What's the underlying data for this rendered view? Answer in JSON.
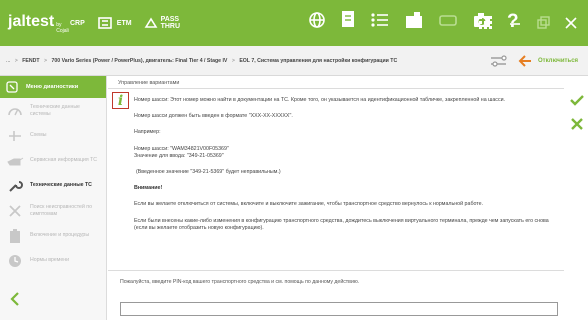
{
  "header": {
    "logo": "jaltest",
    "logo_sub": "by Cojali",
    "crp_label": "CRP",
    "etm_label": "ETM",
    "pass_thru_label_1": "PASS",
    "pass_thru_label_2": "THRU",
    "colors": {
      "brand_green": "#7db83a",
      "alert_red": "#c0392b"
    }
  },
  "breadcrumb": {
    "home": "...",
    "items": [
      "FENDT",
      "700 Vario Series (Power / PowerPlus), двигатель: Final Tier 4 / Stage IV",
      "EOL 7, Система управления для настройки конфигурации ТС"
    ],
    "back_label": "Отключиться"
  },
  "sidebar": {
    "header": "Меню диагностики",
    "items": [
      {
        "label": "Техническиe данные системы",
        "icon": "gauge-icon",
        "active": false
      },
      {
        "label": "Схемы",
        "icon": "schematic-icon",
        "active": false
      },
      {
        "label": "Сервисная информация ТС",
        "icon": "oil-can-icon",
        "active": false
      },
      {
        "label": "Технические данные ТС",
        "icon": "wrench-icon",
        "active": true
      },
      {
        "label": "Поиск неисправностей по симптомам",
        "icon": "tools-icon",
        "active": false
      },
      {
        "label": "Включение и процедуры",
        "icon": "battery-icon",
        "active": false
      },
      {
        "label": "Нормы времени",
        "icon": "clock-icon",
        "active": false
      }
    ]
  },
  "main": {
    "title": "Управление вариантами",
    "paragraphs": [
      "Номер шасси: Этот номер можно найти в документации на ТС. Кроме того, он указывается на идентификационной табличке, закрепленной на шасси.",
      "Номер шасси должен быть введен в формате \"XXX-XX-XXXXX\".",
      "Например:",
      "Номер шасси: \"WAM34821V00F05369\"",
      "Значение для ввода: \"349-21-05369\"",
      "(Введенное значение \"349-21-5369\" будет неправильным.)",
      "Внимание!",
      "Если вы желаете отключиться от системы, включите и выключите зажигание, чтобы транспортное средство вернулось к нормальной работе.",
      "Если были внесены какие-либо изменения в конфигурацию транспортного средства, дождитесь выключения виртуального терминала, прежде чем запускать его снова (если вы желаете отобразить новую конфигурацию)."
    ],
    "prompt": "Пожалуйста, введите PIN-код вашего транспортного средства и см. помощь по данному действию.",
    "pin_value": ""
  }
}
